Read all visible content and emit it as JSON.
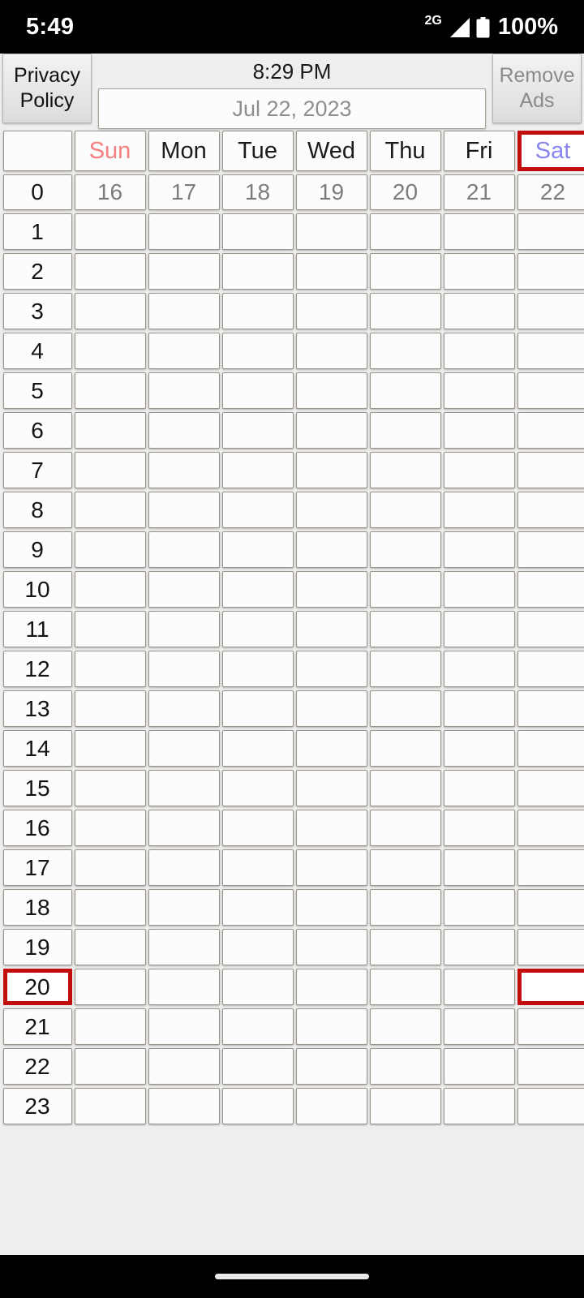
{
  "status_bar": {
    "clock": "5:49",
    "network_type": "2G",
    "battery_percent": "100%",
    "icons": {
      "signal": "signal-bars-icon",
      "battery": "battery-full-icon"
    }
  },
  "top_bar": {
    "privacy_policy_label": "Privacy\nPolicy",
    "privacy_policy_line1": "Privacy",
    "privacy_policy_line2": "Policy",
    "remove_ads_line1": "Remove",
    "remove_ads_line2": "Ads",
    "current_time": "8:29 PM",
    "selected_date": "Jul 22, 2023"
  },
  "calendar": {
    "corner_label": "",
    "day_names": [
      "Sun",
      "Mon",
      "Tue",
      "Wed",
      "Thu",
      "Fri",
      "Sat"
    ],
    "day_numbers": [
      "16",
      "17",
      "18",
      "19",
      "20",
      "21",
      "22"
    ],
    "hours": [
      "0",
      "1",
      "2",
      "3",
      "4",
      "5",
      "6",
      "7",
      "8",
      "9",
      "10",
      "11",
      "12",
      "13",
      "14",
      "15",
      "16",
      "17",
      "18",
      "19",
      "20",
      "21",
      "22",
      "23"
    ],
    "highlighted_day_index": 6,
    "highlighted_hour": "20",
    "highlight_color": "#c10d0d",
    "sunday_color": "#f48080",
    "saturday_color": "#8a86f0",
    "weekday_color": "#1b1b1b",
    "date_number_color": "#7c7c7c",
    "cells": [
      [
        "",
        "",
        "",
        "",
        "",
        "",
        ""
      ],
      [
        "",
        "",
        "",
        "",
        "",
        "",
        ""
      ],
      [
        "",
        "",
        "",
        "",
        "",
        "",
        ""
      ],
      [
        "",
        "",
        "",
        "",
        "",
        "",
        ""
      ],
      [
        "",
        "",
        "",
        "",
        "",
        "",
        ""
      ],
      [
        "",
        "",
        "",
        "",
        "",
        "",
        ""
      ],
      [
        "",
        "",
        "",
        "",
        "",
        "",
        ""
      ],
      [
        "",
        "",
        "",
        "",
        "",
        "",
        ""
      ],
      [
        "",
        "",
        "",
        "",
        "",
        "",
        ""
      ],
      [
        "",
        "",
        "",
        "",
        "",
        "",
        ""
      ],
      [
        "",
        "",
        "",
        "",
        "",
        "",
        ""
      ],
      [
        "",
        "",
        "",
        "",
        "",
        "",
        ""
      ],
      [
        "",
        "",
        "",
        "",
        "",
        "",
        ""
      ],
      [
        "",
        "",
        "",
        "",
        "",
        "",
        ""
      ],
      [
        "",
        "",
        "",
        "",
        "",
        "",
        ""
      ],
      [
        "",
        "",
        "",
        "",
        "",
        "",
        ""
      ],
      [
        "",
        "",
        "",
        "",
        "",
        "",
        ""
      ],
      [
        "",
        "",
        "",
        "",
        "",
        "",
        ""
      ],
      [
        "",
        "",
        "",
        "",
        "",
        "",
        ""
      ],
      [
        "",
        "",
        "",
        "",
        "",
        "",
        ""
      ],
      [
        "",
        "",
        "",
        "",
        "",
        "",
        ""
      ],
      [
        "",
        "",
        "",
        "",
        "",
        "",
        ""
      ],
      [
        "",
        "",
        "",
        "",
        "",
        "",
        ""
      ],
      [
        "",
        "",
        "",
        "",
        "",
        "",
        ""
      ]
    ]
  },
  "nav_bar": {
    "home_handle": "home-indicator"
  }
}
